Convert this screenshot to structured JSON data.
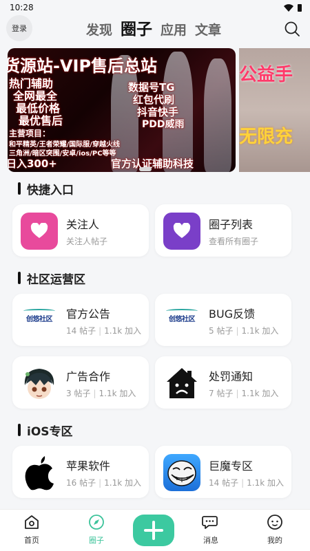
{
  "status_bar": {
    "time": "10:28"
  },
  "header": {
    "login_label": "登录",
    "tabs": [
      {
        "label": "发现",
        "active": false
      },
      {
        "label": "圈子",
        "active": true
      },
      {
        "label": "应用",
        "active": false
      },
      {
        "label": "文章",
        "active": false
      }
    ],
    "search_icon": "search-icon"
  },
  "banner": {
    "main_lines": [
      "货源站-VIP售后总站",
      "热门辅助",
      "全网最全",
      "最低价格",
      "最优售后",
      "数据号TG",
      "红包代刷",
      "抖音快手",
      "PDD威雨",
      "主营项目：",
      "和平精英/王者荣耀/国际服/穿越火线",
      "三角洲/暗区突围/安卓/ios/PC等等",
      "日入300+",
      "官方认证辅助科技"
    ],
    "side_lines": [
      "公益手",
      "无限充"
    ]
  },
  "sections": {
    "quick": {
      "title": "快捷入口",
      "cards": [
        {
          "title": "关注人",
          "sub": "关注人帖子",
          "icon": "heart-icon",
          "color": "#e84a9c"
        },
        {
          "title": "圈子列表",
          "sub": "查看所有圈子",
          "icon": "heart-icon",
          "color": "#7a3fc8"
        }
      ]
    },
    "community": {
      "title": "社区运营区",
      "cards": [
        {
          "title": "官方公告",
          "posts": "14 帖子",
          "joins": "1.1k 加入",
          "icon": "chuangyou-logo-icon",
          "logo_text": "创悠社区"
        },
        {
          "title": "BUG反馈",
          "posts": "5 帖子",
          "joins": "1.1k 加入",
          "icon": "chuangyou-logo-icon",
          "logo_text": "创悠社区"
        },
        {
          "title": "广告合作",
          "posts": "3 帖子",
          "joins": "1.1k 加入",
          "icon": "anime-avatar-icon"
        },
        {
          "title": "处罚通知",
          "posts": "7 帖子",
          "joins": "1.1k 加入",
          "icon": "sad-house-icon"
        }
      ]
    },
    "ios": {
      "title": "iOS专区",
      "cards": [
        {
          "title": "苹果软件",
          "posts": "16 帖子",
          "joins": "1.1k 加入",
          "icon": "apple-icon"
        },
        {
          "title": "巨魔专区",
          "posts": "14 帖子",
          "joins": "1.1k 加入",
          "icon": "trollface-icon"
        }
      ]
    }
  },
  "bottom_nav": {
    "items": [
      {
        "label": "首页",
        "icon": "home-icon",
        "active": false
      },
      {
        "label": "圈子",
        "icon": "compass-icon",
        "active": true
      },
      {
        "label": "消息",
        "icon": "message-icon",
        "active": false
      },
      {
        "label": "我的",
        "icon": "profile-icon",
        "active": false
      }
    ],
    "add_icon": "plus-icon"
  },
  "colors": {
    "accent": "#3cc9a0",
    "pink": "#e84a9c",
    "purple": "#7a3fc8"
  }
}
